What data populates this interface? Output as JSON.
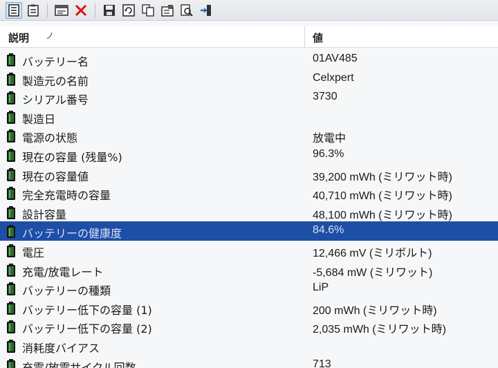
{
  "header": {
    "description_label": "説明",
    "sort_indicator": "ノ",
    "value_label": "値"
  },
  "toolbar": {
    "buttons": [
      {
        "name": "report-view-icon"
      },
      {
        "name": "clipboard-icon"
      },
      {
        "name": "html-report-icon"
      },
      {
        "name": "delete-icon"
      },
      {
        "name": "save-icon"
      },
      {
        "name": "refresh-icon"
      },
      {
        "name": "copy-icon"
      },
      {
        "name": "properties-icon"
      },
      {
        "name": "find-icon"
      },
      {
        "name": "exit-icon"
      }
    ]
  },
  "colors": {
    "selection": "#1f4ea6",
    "battery_icon": "#2c6b2c"
  },
  "rows": [
    {
      "label": "バッテリー名",
      "value": "01AV485"
    },
    {
      "label": "製造元の名前",
      "value": "Celxpert"
    },
    {
      "label": "シリアル番号",
      "value": "3730"
    },
    {
      "label": "製造日",
      "value": ""
    },
    {
      "label": "電源の状態",
      "value": "放電中"
    },
    {
      "label": "現在の容量 (残量%)",
      "value": "96.3%"
    },
    {
      "label": "現在の容量値",
      "value": "39,200 mWh (ミリワット時)"
    },
    {
      "label": "完全充電時の容量",
      "value": "40,710 mWh (ミリワット時)"
    },
    {
      "label": "設計容量",
      "value": "48,100 mWh (ミリワット時)"
    },
    {
      "label": "バッテリーの健康度",
      "value": "84.6%",
      "selected": true
    },
    {
      "label": "電圧",
      "value": "12,466 mV (ミリボルト)"
    },
    {
      "label": "充電/放電レート",
      "value": "-5,684 mW (ミリワット)"
    },
    {
      "label": "バッテリーの種類",
      "value": "LiP"
    },
    {
      "label": "バッテリー低下の容量 (1)",
      "value": "200 mWh (ミリワット時)"
    },
    {
      "label": "バッテリー低下の容量 (2)",
      "value": "2,035 mWh (ミリワット時)"
    },
    {
      "label": "消耗度バイアス",
      "value": ""
    },
    {
      "label": "充電/放電サイクル回数",
      "value": "713"
    }
  ]
}
